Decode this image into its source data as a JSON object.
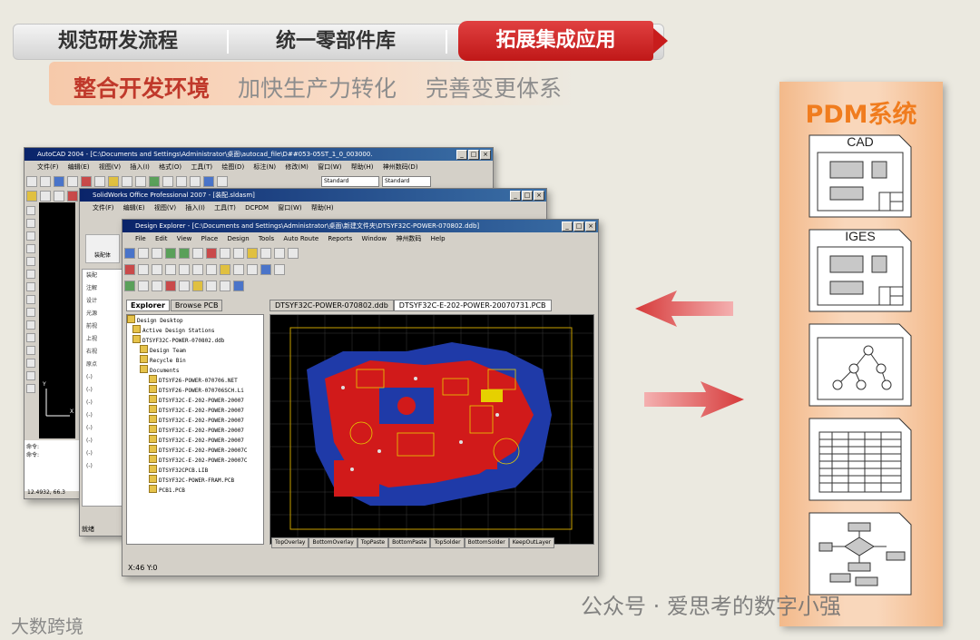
{
  "tabs": {
    "tab1": "规范研发流程",
    "tab2": "统一零部件库",
    "tab3": "拓展集成应用"
  },
  "subtabs": {
    "s1": "整合开发环境",
    "s2": "加快生产力转化",
    "s3": "完善变更体系"
  },
  "autocad": {
    "title": "AutoCAD 2004 - [C:\\Documents and Settings\\Administrator\\桌面\\autocad_file\\D##053-05ST_1_0_003000.",
    "menus": [
      "文件(F)",
      "编辑(E)",
      "视图(V)",
      "插入(I)",
      "格式(O)",
      "工具(T)",
      "绘图(D)",
      "标注(N)",
      "修改(M)",
      "窗口(W)",
      "帮助(H)",
      "神州数码(D)"
    ],
    "dropdown1": "Standard",
    "dropdown2": "Standard",
    "cmd_line1": "命令:",
    "cmd_line2": "命令:",
    "coords": "12.4932, 66.3"
  },
  "solidworks": {
    "title": "SolidWorks Office Professional 2007 - [装配.sldasm]",
    "menus": [
      "文件(F)",
      "编辑(E)",
      "视图(V)",
      "插入(I)",
      "工具(T)",
      "DCPDM",
      "窗口(W)",
      "帮助(H)"
    ],
    "big_button": "装配体",
    "tree": [
      "装配",
      "注解",
      "设计",
      "光源",
      "前视",
      "上视",
      "右视",
      "原点",
      "(-)",
      "(-)",
      "(-)",
      "(-)",
      "(-)",
      "(-)",
      "(-)",
      "(-)"
    ],
    "status": "就绪"
  },
  "design_explorer": {
    "title": "Design Explorer - [C:\\Documents and Settings\\Administrator\\桌面\\新建文件夹\\DTSYF32C-POWER-070802.ddb]",
    "menus": [
      "File",
      "Edit",
      "View",
      "Place",
      "Design",
      "Tools",
      "Auto Route",
      "Reports",
      "Window",
      "神州数码",
      "Help"
    ],
    "panel_tabs": [
      "Explorer",
      "Browse PCB"
    ],
    "tree": [
      "Design Desktop",
      "Active Design Stations",
      "DTSYF32C-POWER-070802.ddb",
      "Design Team",
      "Recycle Bin",
      "Documents",
      "DTSYF26-POWER-070706.NET",
      "DTSYF26-POWER-070706SCH.Li",
      "DTSYF32C-E-202-POWER-20007",
      "DTSYF32C-E-202-POWER-20007",
      "DTSYF32C-E-202-POWER-20007",
      "DTSYF32C-E-202-POWER-20007",
      "DTSYF32C-E-202-POWER-20007",
      "DTSYF32C-E-202-POWER-20007C",
      "DTSYF32C-E-202-POWER-20007C",
      "DTSYF32CPCB.LIB",
      "DTSYF32C-POWER-FRAM.PCB",
      "PCB1.PCB"
    ],
    "doc_tabs": [
      "DTSYF32C-POWER-070802.ddb",
      "DTSYF32C-E-202-POWER-20070731.PCB"
    ],
    "layer_tabs": [
      "TopOverlay",
      "BottomOverlay",
      "TopPaste",
      "BottomPaste",
      "TopSolder",
      "BottomSolder",
      "KeepOutLayer"
    ],
    "status": "X:46 Y:0"
  },
  "pdm": {
    "title": "PDM系统",
    "doc1": "CAD",
    "doc2": "IGES"
  },
  "watermark": {
    "wechat": "公众号 · 爱思考的数字小强",
    "logo": "大数跨境"
  },
  "colors": {
    "accent_red": "#c81c1c",
    "pdm_orange": "#f07c1e",
    "subtab_red": "#c0392b"
  }
}
